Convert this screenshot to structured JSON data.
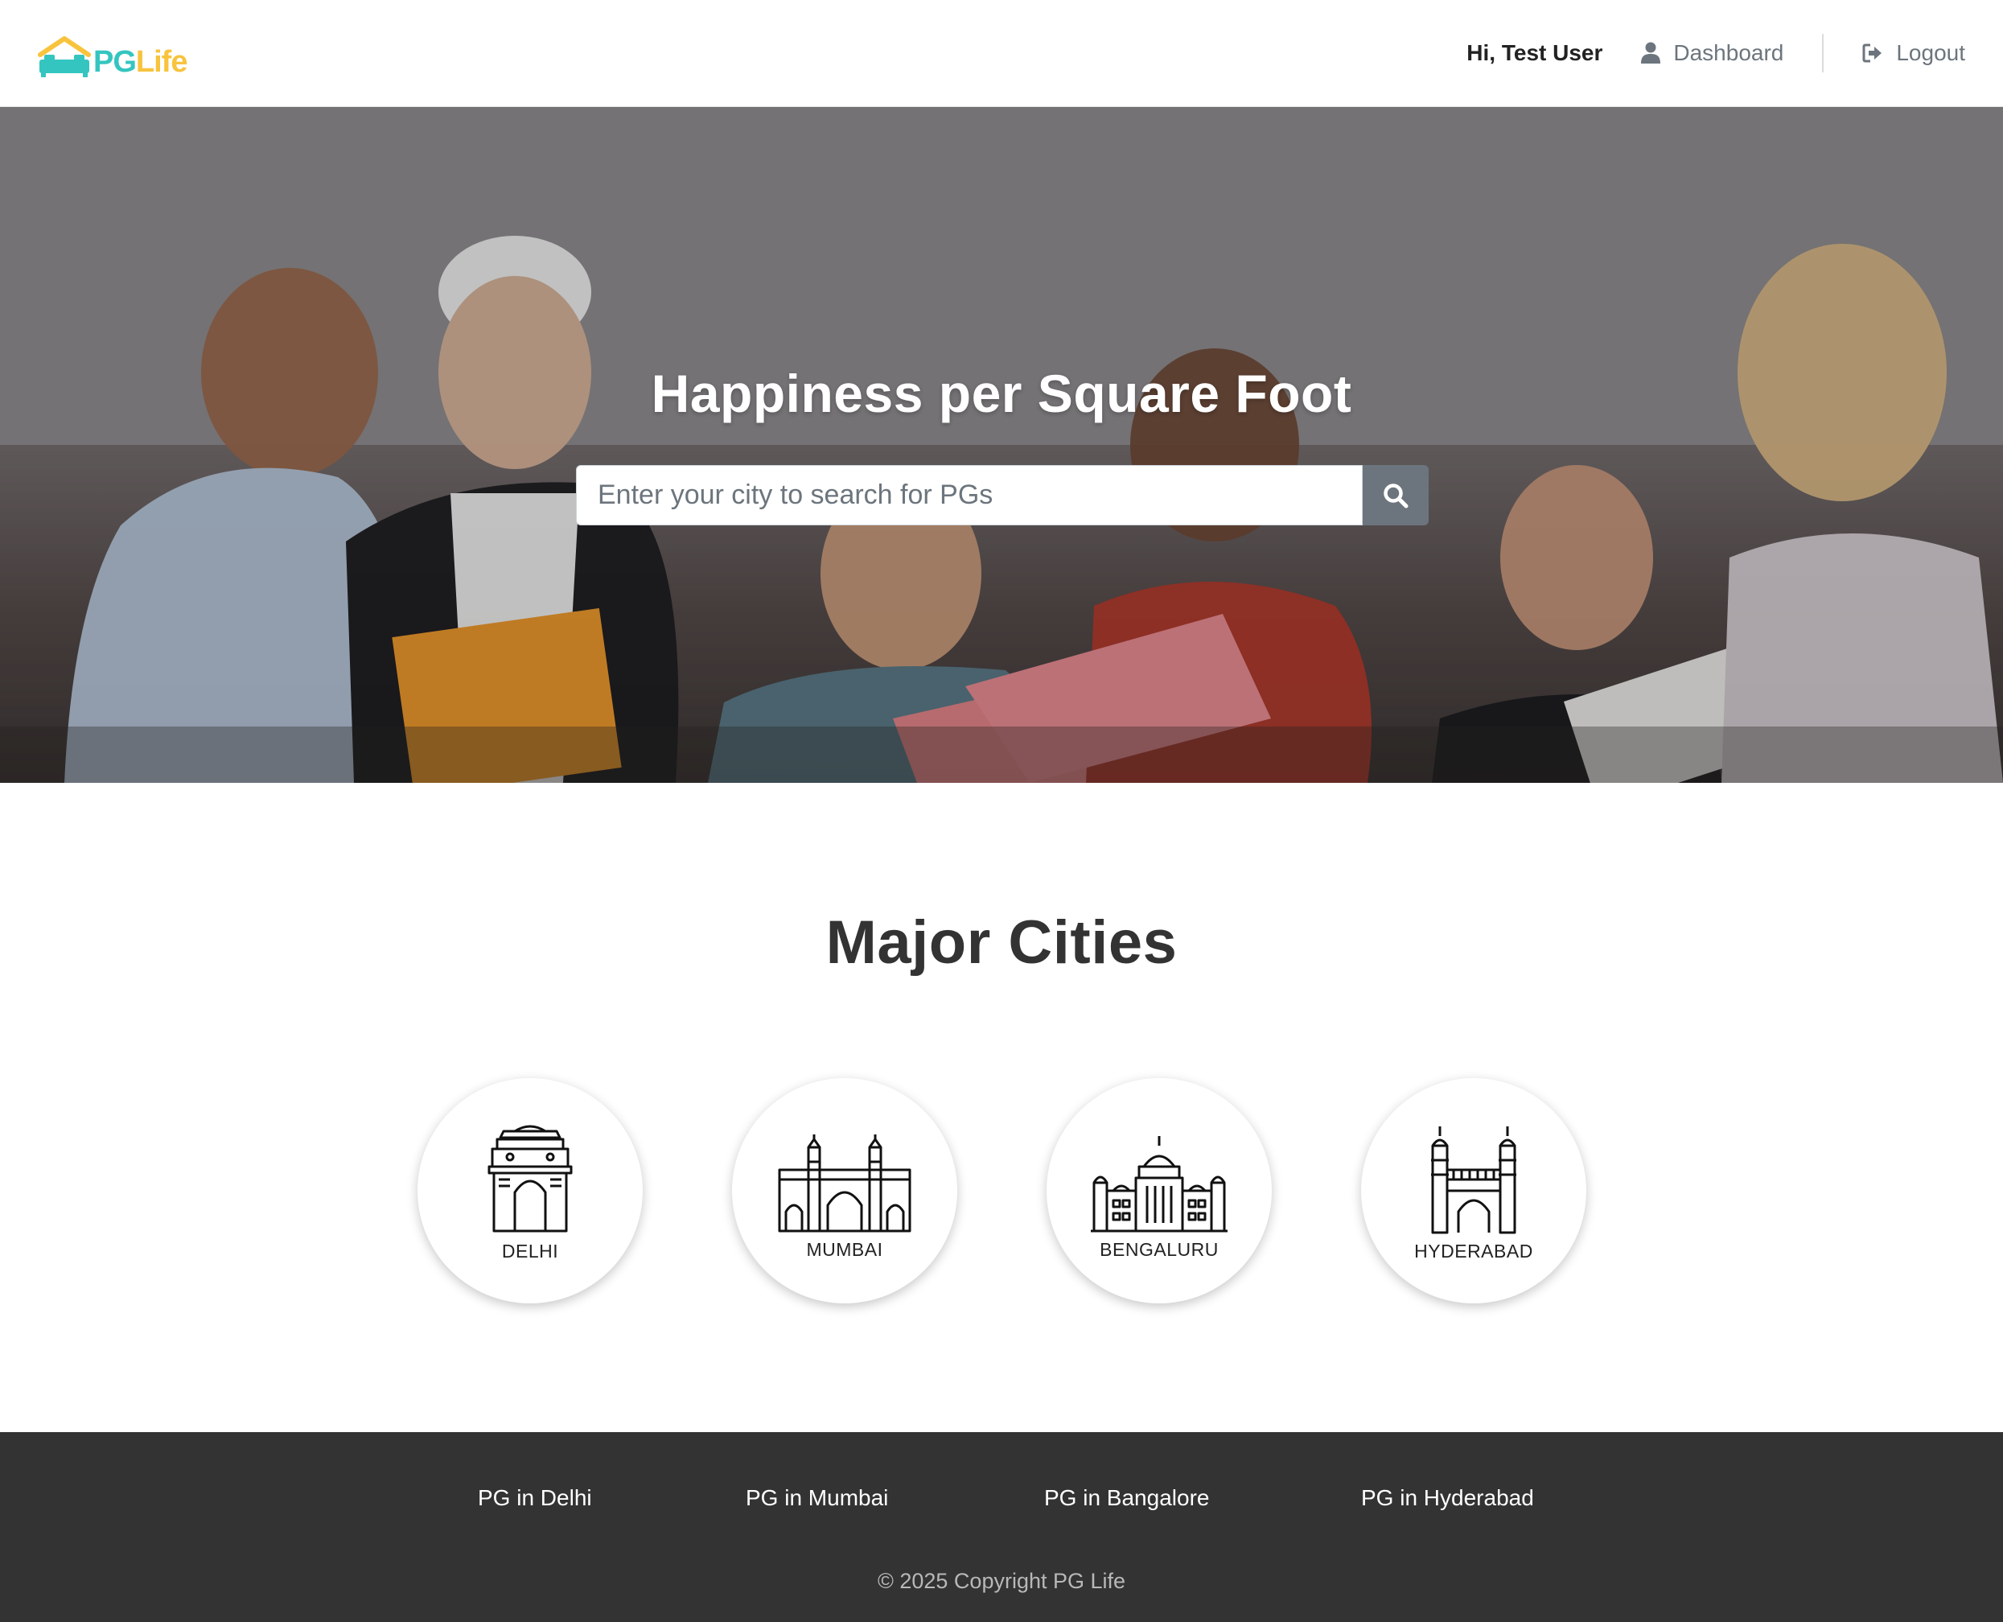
{
  "header": {
    "logo": {
      "pg": "PG",
      "life": "Life"
    },
    "greeting": "Hi, Test User",
    "dashboard_label": "Dashboard",
    "logout_label": "Logout"
  },
  "hero": {
    "title": "Happiness per Square Foot",
    "search_placeholder": "Enter your city to search for PGs"
  },
  "cities": {
    "title": "Major Cities",
    "items": [
      {
        "label": "DELHI",
        "icon": "india-gate-icon"
      },
      {
        "label": "MUMBAI",
        "icon": "gateway-of-india-icon"
      },
      {
        "label": "BENGALURU",
        "icon": "vidhana-soudha-icon"
      },
      {
        "label": "HYDERABAD",
        "icon": "charminar-icon"
      }
    ]
  },
  "footer": {
    "links": [
      "PG in Delhi",
      "PG in Mumbai",
      "PG in Bangalore",
      "PG in Hyderabad"
    ],
    "copyright": "© 2025 Copyright PG Life"
  },
  "colors": {
    "brand_teal": "#35c5c0",
    "brand_yellow": "#f8c33d",
    "footer_bg": "#333333",
    "search_button": "#6c757d"
  }
}
